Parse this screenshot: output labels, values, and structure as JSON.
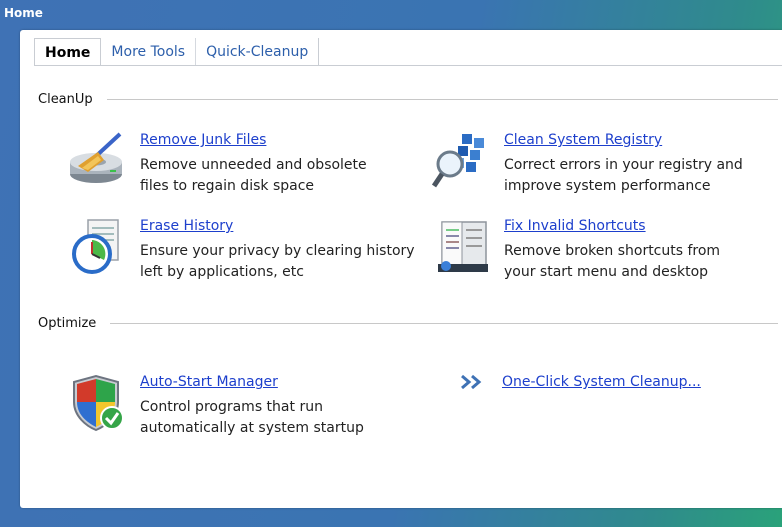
{
  "window": {
    "title": "Home"
  },
  "tabs": [
    {
      "label": "Home",
      "active": true
    },
    {
      "label": "More Tools",
      "active": false
    },
    {
      "label": "Quick-Cleanup",
      "active": false
    }
  ],
  "sections": {
    "cleanup": {
      "label": "CleanUp",
      "items": [
        {
          "title": "Remove Junk Files",
          "desc1": "Remove unneeded and obsolete",
          "desc2": "files to regain disk space",
          "icon": "broom-disk-icon"
        },
        {
          "title": "Clean System Registry",
          "desc1": "Correct errors in your registry and",
          "desc2": "improve system performance",
          "icon": "registry-magnifier-icon"
        },
        {
          "title": "Erase History",
          "desc1": "Ensure your privacy by clearing history",
          "desc2": "left by applications, etc",
          "icon": "clock-history-icon"
        },
        {
          "title": "Fix Invalid Shortcuts",
          "desc1": "Remove broken shortcuts from",
          "desc2": "your start menu and desktop",
          "icon": "start-menu-icon"
        }
      ]
    },
    "optimize": {
      "label": "Optimize",
      "items": [
        {
          "title": "Auto-Start Manager",
          "desc1": "Control programs that run",
          "desc2": "automatically at system startup",
          "icon": "shield-check-icon"
        }
      ],
      "oneclick": {
        "label": "One-Click System Cleanup...",
        "icon": "double-chevron-right-icon"
      }
    }
  },
  "colors": {
    "link": "#1d3fcc",
    "tab_link": "#2d5fab",
    "titlebar": "#3f72b5"
  }
}
